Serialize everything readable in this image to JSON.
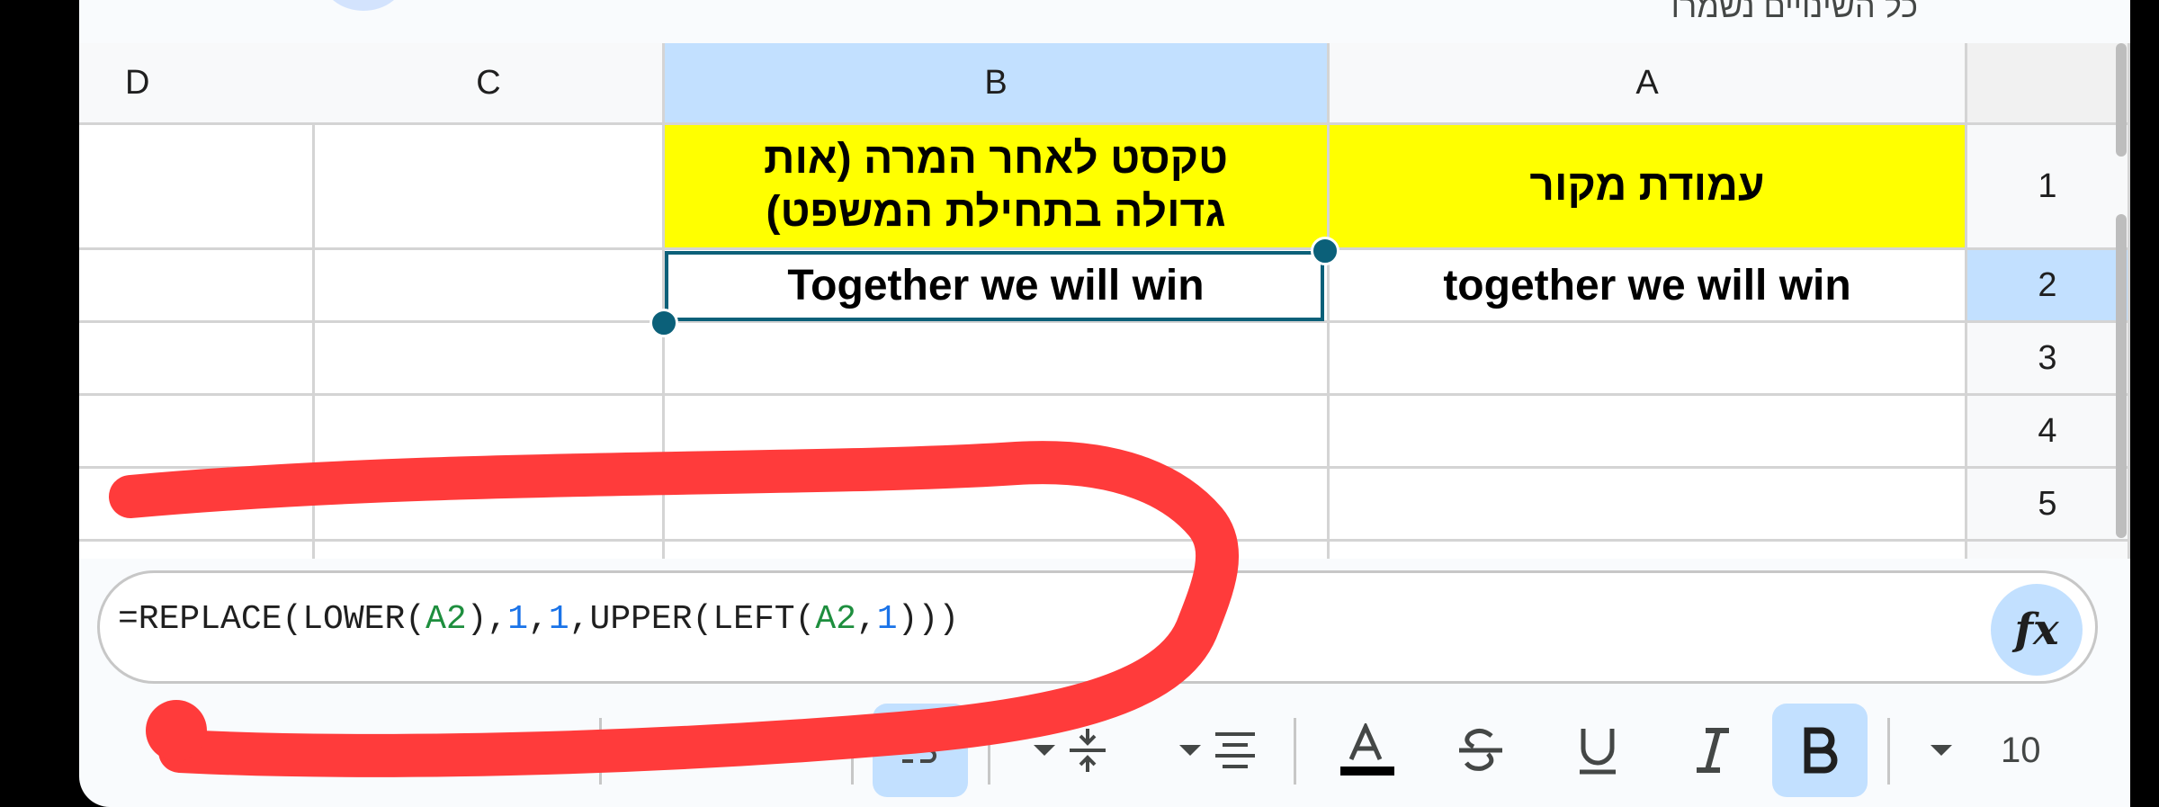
{
  "status": {
    "saved_text": "כל השינויים נשמרו"
  },
  "columns": [
    {
      "id": "D",
      "label": "D"
    },
    {
      "id": "C",
      "label": "C"
    },
    {
      "id": "B",
      "label": "B",
      "selected": true
    },
    {
      "id": "A",
      "label": "A"
    }
  ],
  "rows": [
    {
      "label": "1"
    },
    {
      "label": "2",
      "selected": true
    },
    {
      "label": "3"
    },
    {
      "label": "4"
    },
    {
      "label": "5"
    }
  ],
  "cells": {
    "A1": "עמודת מקור",
    "B1": "טקסט לאחר המרה (אות גדולה בתחילת המשפט)",
    "A2": "together we will win",
    "B2": "Together we will win"
  },
  "header_fill_color": "#ffff00",
  "selection_color": "#0b6079",
  "formula": {
    "p1": "=REPLACE(LOWER(",
    "r1": "A2",
    "p2": "),",
    "n1": "1",
    "p3": ",",
    "n2": "1",
    "p4": ",UPPER(LEFT(",
    "r2": "A2",
    "p5": ",",
    "n3": "1",
    "p6": ")))",
    "fx_label": "fx"
  },
  "toolbar": {
    "font_size": "10",
    "icons": [
      "bold-icon",
      "italic-icon",
      "underline-icon",
      "strikethrough-icon",
      "text-color-icon",
      "horizontal-align-icon",
      "vertical-align-icon",
      "wrap-text-icon",
      "borders-icon",
      "fill-color-icon"
    ]
  },
  "annotation": {
    "color": "#ff3b3b",
    "description": "freehand red scribble"
  }
}
